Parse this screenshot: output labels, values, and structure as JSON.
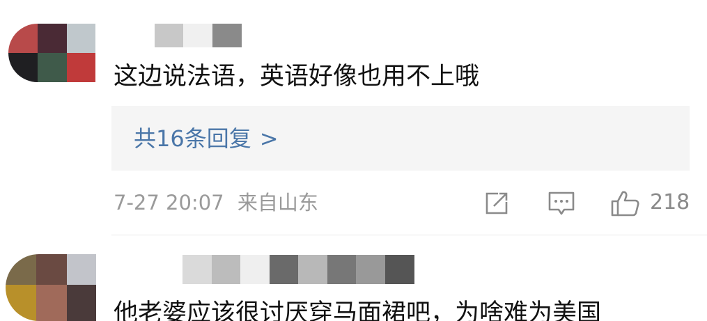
{
  "comments": [
    {
      "text": "这边说法语，英语好像也用不上哦",
      "replies_label": "共16条回复",
      "replies_chevron": ">",
      "time": "7-27 20:07",
      "location": "来自山东",
      "likes": "218",
      "avatar_colors": [
        "#b84a4a",
        "#4a2a35",
        "#c0c8cc",
        "#1f1f22",
        "#3f5a4a",
        "#c03a3a"
      ],
      "name_mosaic_colors": [
        "#c8c8c8",
        "#f0f0f0",
        "#8a8a8a"
      ]
    },
    {
      "text": "他老婆应该很讨厌穿马面裙吧，为啥难为美国",
      "avatar_colors": [
        "#7a6a4a",
        "#6a4a42",
        "#c2c4ca",
        "#b8902a",
        "#a06a5a",
        "#4a3a3a"
      ],
      "name_mosaic_colors": [
        "#dadada",
        "#bcbcbc",
        "#efefef",
        "#6a6a6a",
        "#b8b8b8",
        "#777777",
        "#999999",
        "#555555"
      ]
    }
  ],
  "icons": {
    "share": "share-icon",
    "comment": "comment-icon",
    "like": "thumbs-up-icon"
  },
  "colors": {
    "reply_link": "#4a76a8",
    "meta_text": "#9a9a9a",
    "reply_bg": "#f5f5f5"
  }
}
